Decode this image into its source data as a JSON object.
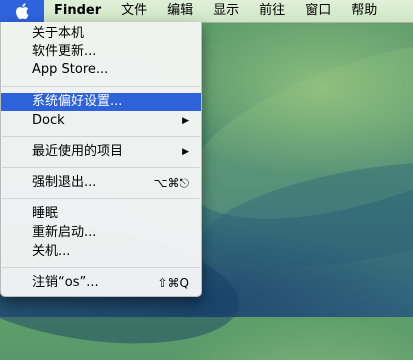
{
  "menubar": {
    "app_name": "Finder",
    "menus": [
      "文件",
      "编辑",
      "显示",
      "前往",
      "窗口",
      "帮助"
    ]
  },
  "apple_menu": {
    "items": [
      {
        "label": "关于本机"
      },
      {
        "label": "软件更新..."
      },
      {
        "label": "App Store..."
      },
      {
        "label": "系统偏好设置..."
      },
      {
        "label": "Dock"
      },
      {
        "label": "最近使用的项目"
      },
      {
        "label": "强制退出...",
        "shortcut": "⌥⌘⎋"
      },
      {
        "label": "睡眠"
      },
      {
        "label": "重新启动..."
      },
      {
        "label": "关机..."
      },
      {
        "label": "注销“os”...",
        "shortcut": "⇧⌘Q"
      }
    ],
    "highlighted_item": "系统偏好设置...",
    "highlight_color": "#2e62db"
  },
  "colors": {
    "apple_button_bg": "#2f63dd",
    "menubar_bg": "#d8ecd0"
  }
}
